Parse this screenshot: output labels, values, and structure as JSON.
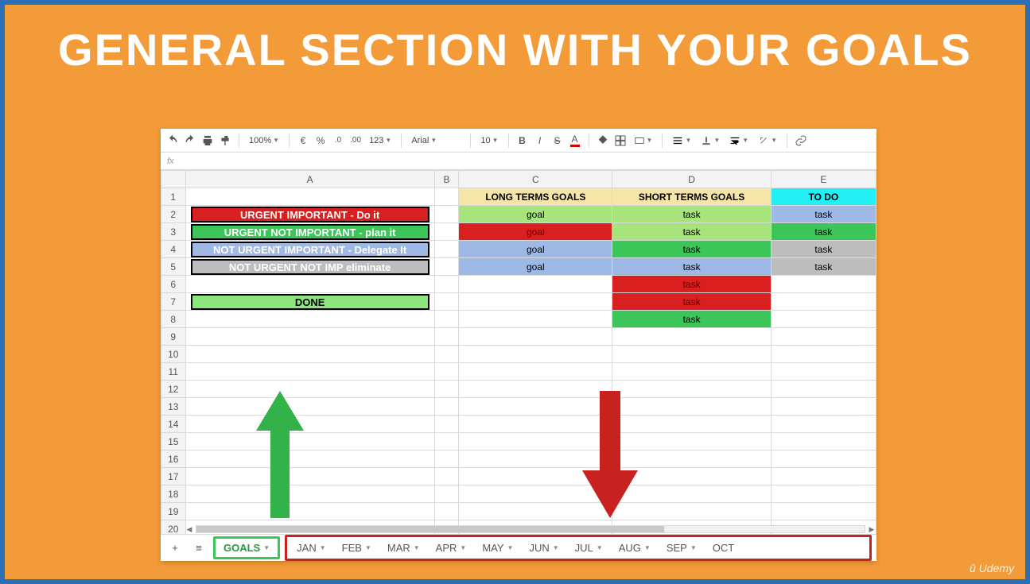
{
  "title": "GENERAL SECTION WITH YOUR GOALS",
  "toolbar": {
    "zoom": "100%",
    "num_format": "123",
    "font": "Arial",
    "font_size": "10"
  },
  "fx_label": "fx",
  "columns": [
    "A",
    "B",
    "C",
    "D",
    "E"
  ],
  "row_count": 20,
  "headers": {
    "c": "LONG TERMS GOALS",
    "d": "SHORT TERMS GOALS",
    "e": "TO DO"
  },
  "legend": {
    "r2": "URGENT IMPORTANT - Do it",
    "r3": "URGENT NOT IMPORTANT - plan it",
    "r4": "NOT URGENT IMPORTANT - Delegate It",
    "r5": "NOT URGENT NOT IMP eliminate",
    "r7": "DONE"
  },
  "cells": {
    "c2": "goal",
    "d2": "task",
    "e2": "task",
    "c3": "goal",
    "d3": "task",
    "e3": "task",
    "c4": "goal",
    "d4": "task",
    "e4": "task",
    "c5": "goal",
    "d5": "task",
    "e5": "task",
    "d6": "task",
    "d7": "task",
    "d8": "task"
  },
  "tabs": {
    "active": "GOALS",
    "months": [
      "JAN",
      "FEB",
      "MAR",
      "APR",
      "MAY",
      "JUN",
      "JUL",
      "AUG",
      "SEP",
      "OCT"
    ]
  },
  "watermark": "Udemy"
}
